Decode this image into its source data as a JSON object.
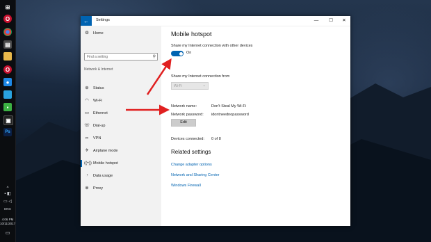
{
  "window": {
    "title": "Settings",
    "back_icon": "←",
    "minimize": "—",
    "maximize": "☐",
    "close": "✕"
  },
  "sidebar": {
    "home": "Home",
    "search_placeholder": "Find a setting",
    "section_header": "Network & Internet",
    "items": [
      {
        "label": "Status",
        "icon": "status-icon"
      },
      {
        "label": "Wi-Fi",
        "icon": "wifi-icon"
      },
      {
        "label": "Ethernet",
        "icon": "ethernet-icon"
      },
      {
        "label": "Dial-up",
        "icon": "dialup-icon"
      },
      {
        "label": "VPN",
        "icon": "vpn-icon"
      },
      {
        "label": "Airplane mode",
        "icon": "airplane-icon"
      },
      {
        "label": "Mobile hotspot",
        "icon": "hotspot-icon",
        "active": true
      },
      {
        "label": "Data usage",
        "icon": "data-usage-icon"
      },
      {
        "label": "Proxy",
        "icon": "proxy-icon"
      }
    ]
  },
  "main": {
    "title": "Mobile hotspot",
    "share_label": "Share my Internet connection with other devices",
    "toggle_state": "On",
    "share_from_label": "Share my Internet connection from",
    "share_from_value": "Wi-Fi",
    "network_name_label": "Network name:",
    "network_name_value": "Don't Steal My Wi-Fi",
    "network_password_label": "Network password:",
    "network_password_value": "idontneednopassword",
    "edit_button": "Edit",
    "devices_label": "Devices connected:",
    "devices_value": "0 of 8",
    "related_title": "Related settings",
    "links": [
      "Change adapter options",
      "Network and Sharing Center",
      "Windows Firewall"
    ]
  },
  "taskbar": {
    "lang": "ENG",
    "time": "4:06 PM",
    "date": "10/11/2017"
  },
  "colors": {
    "accent": "#0063b1",
    "annotation_arrow": "#e02020"
  }
}
